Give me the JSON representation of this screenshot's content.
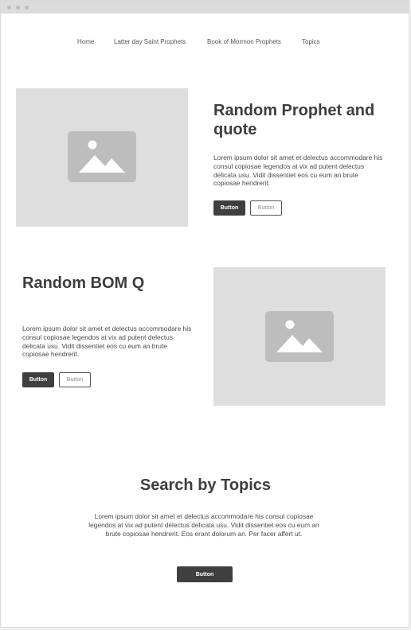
{
  "nav": {
    "items": [
      "Home",
      "Latter day Saint Prophets",
      "Book of Mormon Prophets",
      "Topics"
    ]
  },
  "section1": {
    "title": "Random Prophet and quote",
    "body": "Lorem ipsum dolor sit amet et delectus accommodare his consul copiosae legendos at vix ad putent delectus delicata usu. Vidit dissentiet eos cu eum an brute copiosae hendrerit.",
    "primary_button": "Button",
    "secondary_button": "Button"
  },
  "section2": {
    "title": "Random BOM Q",
    "body": "Lorem ipsum dolor sit amet et delectus accommodare his consul copiosae legendos at vix ad putent delectus delicata usu. Vidit dissentiet eos cu eum an brute copiosae hendrerit.",
    "primary_button": "Button",
    "secondary_button": "Button"
  },
  "section3": {
    "title": "Search by Topics",
    "body": "Lorem ipsum dolor sit amet et delectus accommodare his consul copiosae legendos at vix ad putent delectus delicata usu. Vidit dissentiet eos cu eum an brute copiosae hendrerit. Eos erant dolorum an. Per facer affert ut.",
    "button": "Button"
  },
  "icons": {
    "window_controls": "window-dots-icon",
    "image_placeholder": "image-placeholder-icon"
  },
  "colors": {
    "placeholder": "#dedede",
    "placeholder_icon": "#bdbdbd",
    "dark_button": "#3f3f3f",
    "heading": "#3d3d3d"
  }
}
